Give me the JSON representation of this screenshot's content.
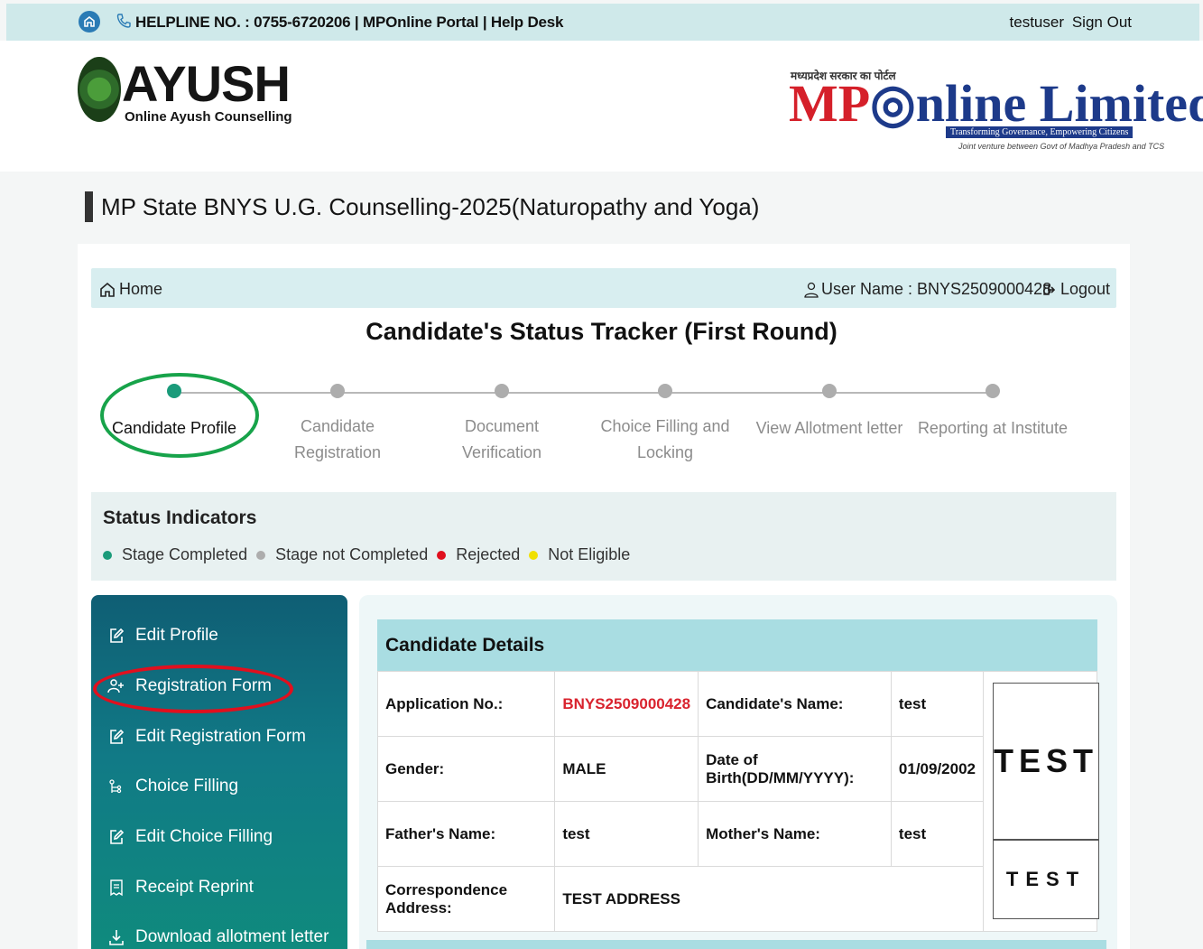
{
  "topbar": {
    "helpline": "HELPLINE NO. : 0755-6720206 |",
    "portal": "MPOnline Portal |",
    "helpdesk": "Help Desk",
    "user": "testuser",
    "signout": "Sign Out"
  },
  "header": {
    "ayush_title": "AYUSH",
    "ayush_sub": "Online Ayush Counselling",
    "mp_hindi": "मध्यप्रदेश सरकार का पोर्टल",
    "mp_title_red": "MP",
    "mp_title_blue": "nline Limited",
    "mp_tagline": "Transforming Governance, Empowering Citizens",
    "mp_jv": "Joint venture between Govt of Madhya Pradesh and TCS"
  },
  "page_title": "MP State BNYS U.G. Counselling-2025(Naturopathy and Yoga)",
  "nav": {
    "home": "Home",
    "user": "User Name : BNYS2509000428",
    "logout": "Logout"
  },
  "tracker": {
    "title": "Candidate's Status Tracker (First Round)",
    "steps": [
      {
        "label": "Candidate Profile",
        "status": "completed"
      },
      {
        "label": "Candidate Registration",
        "status": "not-completed"
      },
      {
        "label": "Document Verification",
        "status": "not-completed"
      },
      {
        "label": "Choice Filling and Locking",
        "status": "not-completed"
      },
      {
        "label": "View Allotment letter",
        "status": "not-completed"
      },
      {
        "label": "Reporting at Institute",
        "status": "not-completed"
      }
    ]
  },
  "status": {
    "title": "Status Indicators",
    "items": [
      {
        "label": "Stage Completed",
        "color": "#1a9b7a"
      },
      {
        "label": "Stage not Completed",
        "color": "#adadad"
      },
      {
        "label": "Rejected",
        "color": "#e0101e"
      },
      {
        "label": "Not Eligible",
        "color": "#f0e000"
      }
    ]
  },
  "sidebar": {
    "items": [
      {
        "label": "Edit Profile",
        "icon": "edit-icon"
      },
      {
        "label": "Registration Form",
        "icon": "add-user-icon"
      },
      {
        "label": "Edit Registration Form",
        "icon": "edit-icon"
      },
      {
        "label": "Choice Filling",
        "icon": "choice-icon"
      },
      {
        "label": "Edit Choice Filling",
        "icon": "edit-icon"
      },
      {
        "label": "Receipt Reprint",
        "icon": "receipt-icon"
      },
      {
        "label": "Download allotment letter",
        "icon": "download-icon"
      }
    ]
  },
  "details": {
    "title": "Candidate Details",
    "app_no_label": "Application No.:",
    "app_no": "BNYS2509000428",
    "name_label": "Candidate's Name:",
    "name": "test",
    "gender_label": "Gender:",
    "gender": "MALE",
    "dob_label": "Date of Birth(DD/MM/YYYY):",
    "dob": "01/09/2002",
    "father_label": "Father's Name:",
    "father": "test",
    "mother_label": "Mother's Name:",
    "mother": "test",
    "address_label": "Correspondence Address:",
    "address": "TEST ADDRESS",
    "photo_text": "TEST",
    "sign_text": "TEST"
  }
}
